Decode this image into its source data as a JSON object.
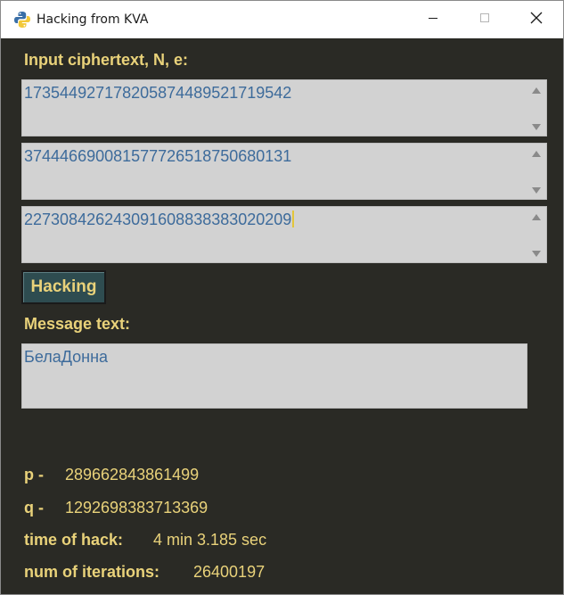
{
  "window": {
    "title": "Hacking from KVA",
    "icon": "python-icon"
  },
  "inputs": {
    "label": "Input ciphertext, N, e:",
    "ciphertext": "173544927178205874489521719542",
    "n": "374446690081577726518750680131",
    "e": "227308426243091608838383020209"
  },
  "hack_button": {
    "label": "Hacking"
  },
  "message": {
    "label": "Message text:",
    "value": "БелаДонна"
  },
  "stats": {
    "p_label": "p -",
    "p_value": "289662843861499",
    "q_label": "q -",
    "q_value": "1292698383713369",
    "time_label": "time of hack:",
    "time_value": "4 min 3.185 sec",
    "iter_label": "num of iterations:",
    "iter_value": "26400197"
  },
  "colors": {
    "background": "#2a2a25",
    "accent_text": "#e9d27a",
    "input_text": "#3d6b9b",
    "input_bg": "#d2d2d2",
    "button_bg": "#2e4c50"
  }
}
